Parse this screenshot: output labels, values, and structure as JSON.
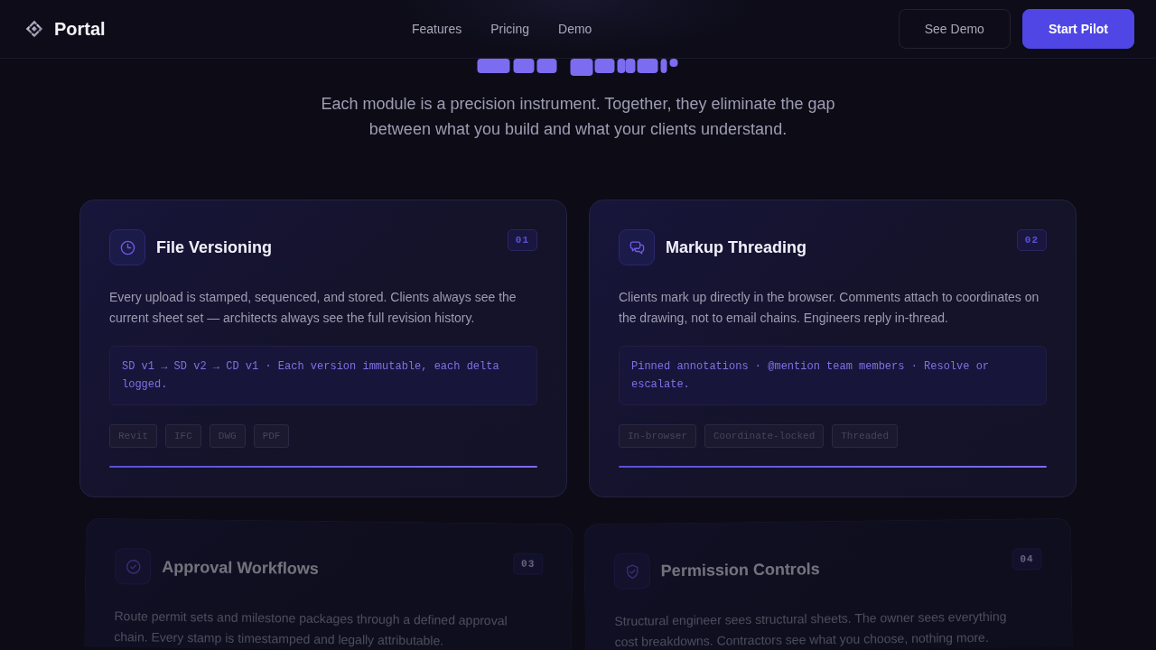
{
  "header": {
    "brand": "Portal",
    "links": [
      {
        "label": "Features"
      },
      {
        "label": "Pricing"
      },
      {
        "label": "Demo"
      }
    ],
    "buttons": [
      {
        "label": "See Demo",
        "kind": "outline"
      },
      {
        "label": "Start Pilot",
        "kind": "primary"
      }
    ]
  },
  "hero": {
    "subtitle": "Each module is a precision instrument. Together, they eliminate the gap between what you build and what your clients understand."
  },
  "modules": [
    {
      "number": "01",
      "title": "File Versioning",
      "description": "Every upload is stamped, sequenced, and stored. Clients always see the current sheet set — architects always see the full revision history.",
      "note": "SD v1 → SD v2 → CD v1 · Each version immutable, each delta logged.",
      "tags": [
        "Revit",
        "IFC",
        "DWG",
        "PDF"
      ],
      "revealed": true
    },
    {
      "number": "02",
      "title": "Markup Threading",
      "description": "Clients mark up directly in the browser. Comments attach to coordinates on the drawing, not to email chains. Engineers reply in-thread.",
      "note": "Pinned annotations · @mention team members · Resolve or escalate.",
      "tags": [
        "In-browser",
        "Coordinate-locked",
        "Threaded"
      ],
      "revealed": true
    },
    {
      "number": "03",
      "title": "Approval Workflows",
      "description": "Route permit sets and milestone packages through a defined approval chain. Every stamp is timestamped and legally attributable.",
      "revealed": false
    },
    {
      "number": "04",
      "title": "Permission Controls",
      "description": "Structural engineer sees structural sheets. The owner sees everything",
      "description_continued": "cost breakdowns. Contractors see what you choose, nothing more.",
      "revealed": false
    }
  ]
}
